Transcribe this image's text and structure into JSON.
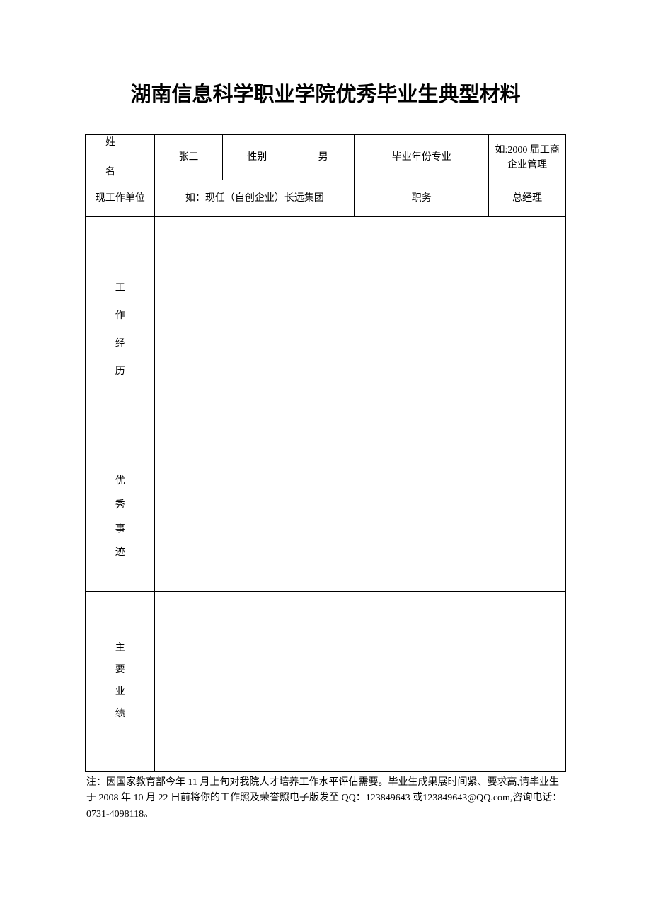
{
  "title": "湖南信息科学职业学院优秀毕业生典型材料",
  "row1": {
    "name_label_a": "姓",
    "name_label_b": "名",
    "name_value": "张三",
    "gender_label": "性别",
    "gender_value": "男",
    "gradyear_label": "毕业年份专业",
    "gradyear_value": "如:2000 届工商企业管理"
  },
  "row2": {
    "workunit_label": "现工作单位",
    "workunit_value": "如：现任（自创企业）长远集团",
    "position_label": "职务",
    "position_value": "总经理"
  },
  "row3": {
    "label_c1": "工",
    "label_c2": "作",
    "label_c3": "经",
    "label_c4": "历",
    "content": ""
  },
  "row4": {
    "label_c1": "优",
    "label_c2": "秀",
    "label_c3": "事",
    "label_c4": "迹",
    "content": ""
  },
  "row5": {
    "label_c1": "主",
    "label_c2": "要",
    "label_c3": "业",
    "label_c4": "绩",
    "content": ""
  },
  "footnote": "注：因国家教育部今年 11 月上旬对我院人才培养工作水平评估需要。毕业生成果展时间紧、要求高,请毕业生于 2008 年 10 月 22 日前将你的工作照及荣誉照电子版发至 QQ：123849643 或123849643@QQ.com,咨询电话：0731-4098118。"
}
